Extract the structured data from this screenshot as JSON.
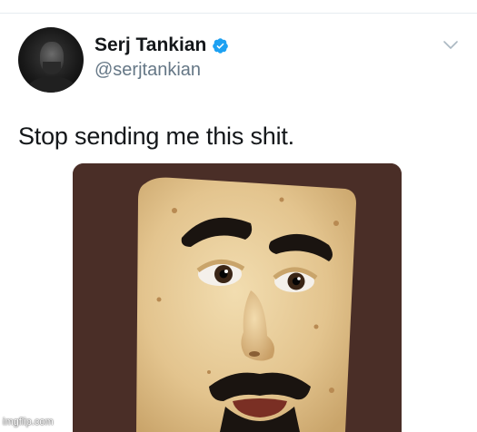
{
  "tweet": {
    "display_name": "Serj Tankian",
    "handle": "@serjtankian",
    "text": "Stop sending me this shit.",
    "verified": true
  },
  "icons": {
    "verified": "verified-badge-icon",
    "more": "chevron-down-icon"
  },
  "colors": {
    "verified_blue": "#1da1f2",
    "media_background": "#4a2e27",
    "handle_gray": "#657786"
  },
  "watermark": "imgflip.com"
}
